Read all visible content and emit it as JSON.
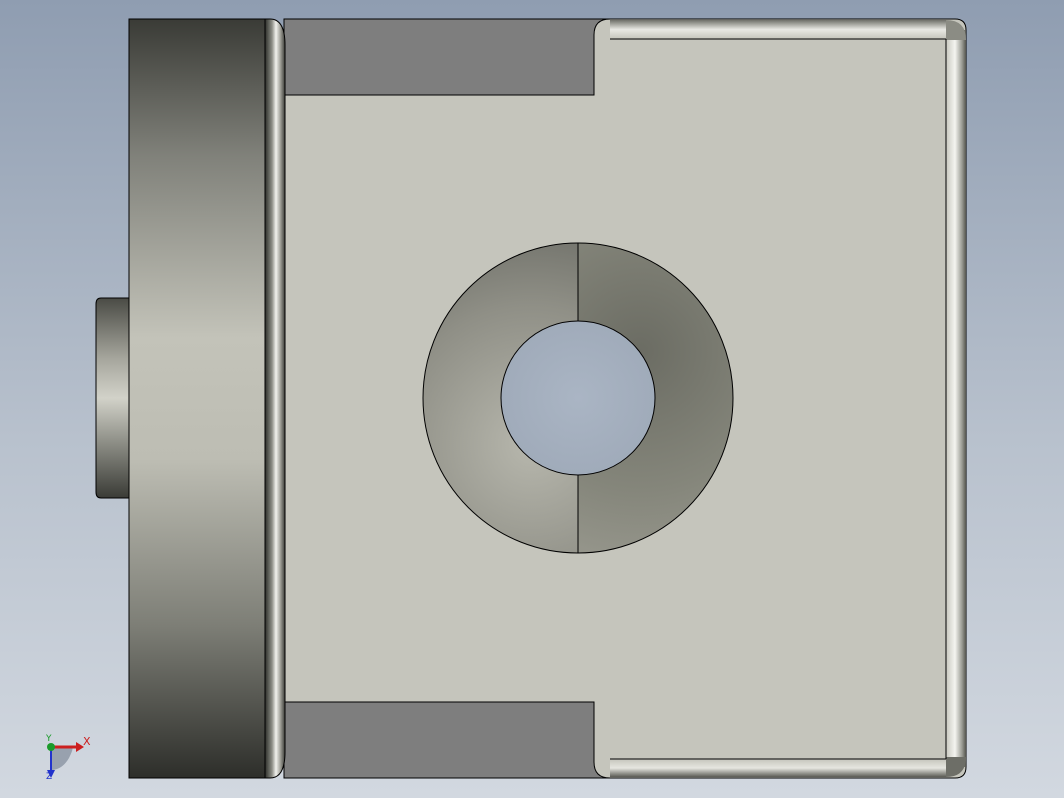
{
  "viewport": {
    "background_top": "#8f9db1",
    "background_bottom": "#d2d8e0"
  },
  "model": {
    "face_color": "#c5c5bc",
    "shadow_color": "#2f302b",
    "recess_color": "#7e7e7e",
    "edge_color": "#000000"
  },
  "triad": {
    "x_label": "X",
    "y_label": "Y",
    "z_label": "Z",
    "x_color": "#cc1f1f",
    "y_color": "#1a9a2a",
    "z_color": "#2233cc"
  }
}
